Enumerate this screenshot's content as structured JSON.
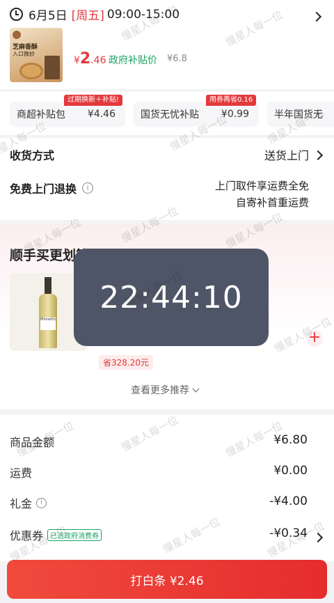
{
  "delivery": {
    "date": "6月5日",
    "weekday": "[周五]",
    "time": "09:00-15:00"
  },
  "product": {
    "thumb_text_1": "芝麻香酥",
    "thumb_text_2": "入口微妙",
    "currency": "¥",
    "price_int": "2",
    "price_dec": ".46",
    "price_note": "政府补贴价",
    "original_price": "¥6.8"
  },
  "promo_chips": [
    {
      "label": "商超补贴包",
      "price": "¥4.46",
      "tag": "过期换新＋补贴!"
    },
    {
      "label": "国货无忧补贴",
      "price": "¥0.99",
      "tag": "用券再省0.16"
    },
    {
      "label": "半年国货无"
    }
  ],
  "shipping": {
    "label": "收货方式",
    "value": "送货上门"
  },
  "returns": {
    "label": "免费上门退换",
    "line1": "上门取件享运费全免",
    "line2": "自寄补首重运费"
  },
  "recommend": {
    "title": "顺手买更划算",
    "save": "省328.20元",
    "more": "查看更多推荐",
    "bottle_label": "Mionetto"
  },
  "overlay_time": "22:44:10",
  "summary": {
    "goods": {
      "label": "商品金额",
      "value": "¥6.80"
    },
    "freight": {
      "label": "运费",
      "value": "¥0.00"
    },
    "gift": {
      "label": "礼金",
      "value": "-¥4.00"
    },
    "coupon": {
      "label": "优惠券",
      "badge": "已选政府消费券",
      "value": "-¥0.34"
    }
  },
  "pay_button": "打白条 ¥2.46",
  "watermark": "慢星人每一位",
  "colors": {
    "accent": "#e4393c",
    "overlay": "#4e5566",
    "green": "#1aa260"
  }
}
